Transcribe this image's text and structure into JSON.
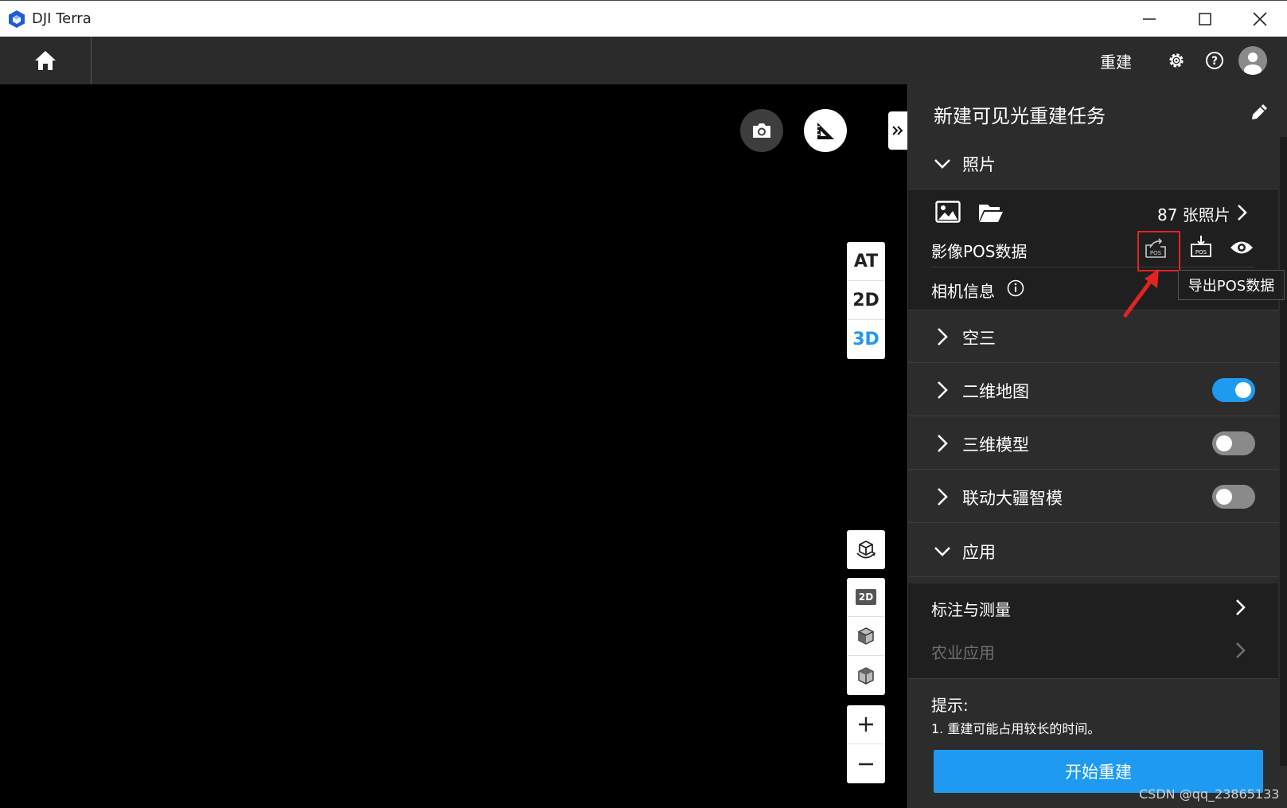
{
  "window": {
    "title": "DJI Terra"
  },
  "topbar": {
    "rebuild_label": "重建"
  },
  "viewport": {
    "modes": [
      "AT",
      "2D",
      "3D"
    ],
    "active_mode": "3D",
    "view_2d_badge": "2D"
  },
  "panel": {
    "title": "新建可见光重建任务",
    "photos": {
      "label": "照片",
      "count": "87 张照片",
      "pos_label": "影像POS数据",
      "camera_label": "相机信息"
    },
    "sections": [
      {
        "label": "空三"
      },
      {
        "label": "二维地图",
        "toggle": true
      },
      {
        "label": "三维模型",
        "toggle": false
      },
      {
        "label": "联动大疆智模",
        "toggle": false
      }
    ],
    "apps": {
      "label": "应用",
      "items": [
        {
          "label": "标注与测量",
          "enabled": true
        },
        {
          "label": "农业应用",
          "enabled": false
        }
      ]
    },
    "hint_title": "提示:",
    "hint_text": "1. 重建可能占用较长的时间。",
    "start_label": "开始重建",
    "tooltip": "导出POS数据"
  },
  "colors": {
    "accent": "#1e9bf0",
    "highlight": "#e02424",
    "toggle_off": "#8a8a8a"
  },
  "watermark": "CSDN @qq_23865133"
}
